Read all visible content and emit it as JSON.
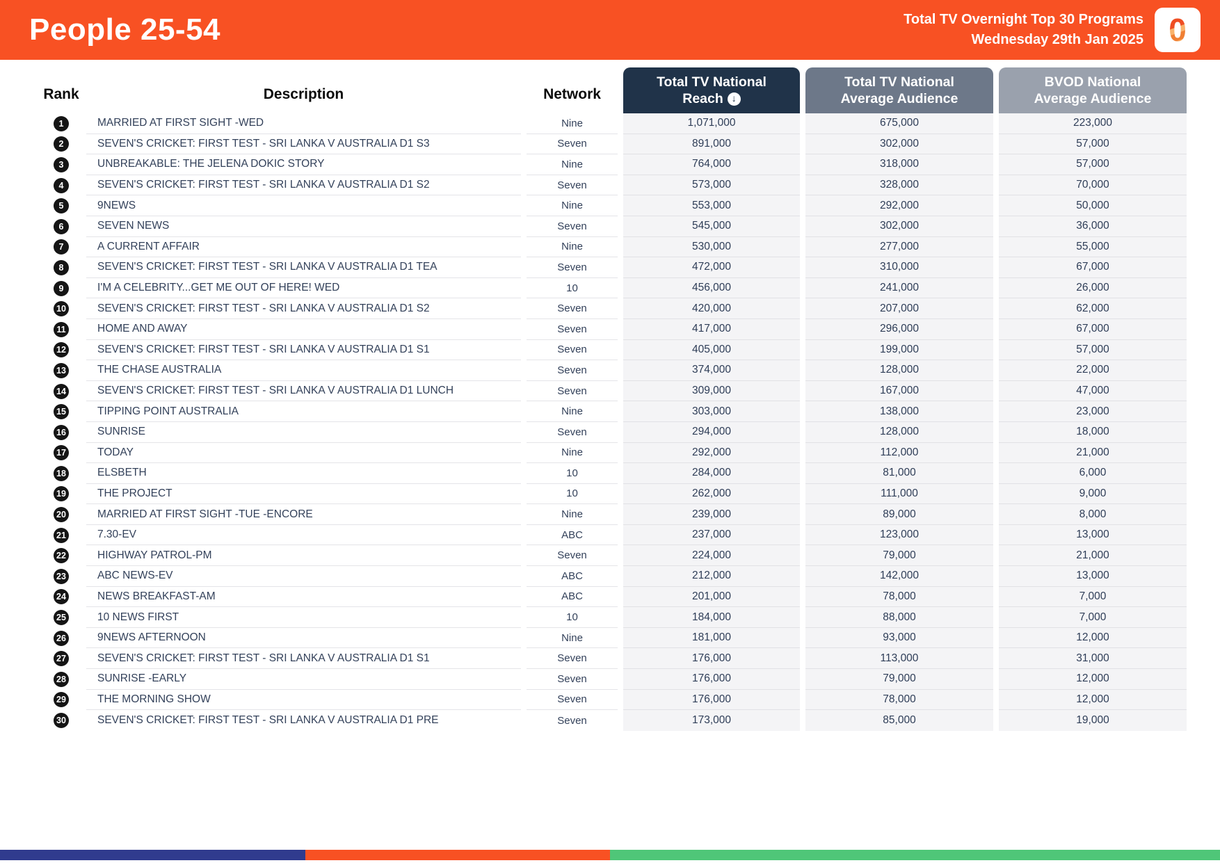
{
  "header": {
    "title": "People 25-54",
    "subtitle_line1": "Total TV Overnight Top 30 Programs",
    "subtitle_line2": "Wednesday 29th Jan 2025",
    "logo_text": "0",
    "bg_color": "#F85123"
  },
  "table": {
    "columns": {
      "rank": "Rank",
      "description": "Description",
      "network": "Network",
      "reach_line1": "Total TV National",
      "reach_line2": "Reach",
      "avg_line1": "Total TV National",
      "avg_line2": "Average Audience",
      "bvod_line1": "BVOD National",
      "bvod_line2": "Average Audience"
    },
    "sort_icon": "↓",
    "header_colors": {
      "reach": "#203349",
      "avg": "#6D7889",
      "bvod": "#9AA1AD"
    },
    "rows": [
      {
        "rank": "1",
        "description": "MARRIED AT FIRST SIGHT -WED",
        "network": "Nine",
        "reach": "1,071,000",
        "avg": "675,000",
        "bvod": "223,000"
      },
      {
        "rank": "2",
        "description": "SEVEN'S CRICKET: FIRST TEST - SRI LANKA V AUSTRALIA D1 S3",
        "network": "Seven",
        "reach": "891,000",
        "avg": "302,000",
        "bvod": "57,000"
      },
      {
        "rank": "3",
        "description": "UNBREAKABLE: THE JELENA DOKIC STORY",
        "network": "Nine",
        "reach": "764,000",
        "avg": "318,000",
        "bvod": "57,000"
      },
      {
        "rank": "4",
        "description": "SEVEN'S CRICKET: FIRST TEST - SRI LANKA V AUSTRALIA D1 S2",
        "network": "Seven",
        "reach": "573,000",
        "avg": "328,000",
        "bvod": "70,000"
      },
      {
        "rank": "5",
        "description": "9NEWS",
        "network": "Nine",
        "reach": "553,000",
        "avg": "292,000",
        "bvod": "50,000"
      },
      {
        "rank": "6",
        "description": "SEVEN NEWS",
        "network": "Seven",
        "reach": "545,000",
        "avg": "302,000",
        "bvod": "36,000"
      },
      {
        "rank": "7",
        "description": "A CURRENT AFFAIR",
        "network": "Nine",
        "reach": "530,000",
        "avg": "277,000",
        "bvod": "55,000"
      },
      {
        "rank": "8",
        "description": "SEVEN'S CRICKET: FIRST TEST - SRI LANKA V AUSTRALIA D1 TEA",
        "network": "Seven",
        "reach": "472,000",
        "avg": "310,000",
        "bvod": "67,000"
      },
      {
        "rank": "9",
        "description": "I'M A CELEBRITY...GET ME OUT OF HERE! WED",
        "network": "10",
        "reach": "456,000",
        "avg": "241,000",
        "bvod": "26,000"
      },
      {
        "rank": "10",
        "description": "SEVEN'S CRICKET: FIRST TEST - SRI LANKA V AUSTRALIA D1 S2",
        "network": "Seven",
        "reach": "420,000",
        "avg": "207,000",
        "bvod": "62,000"
      },
      {
        "rank": "11",
        "description": "HOME AND AWAY",
        "network": "Seven",
        "reach": "417,000",
        "avg": "296,000",
        "bvod": "67,000"
      },
      {
        "rank": "12",
        "description": "SEVEN'S CRICKET: FIRST TEST - SRI LANKA V AUSTRALIA D1 S1",
        "network": "Seven",
        "reach": "405,000",
        "avg": "199,000",
        "bvod": "57,000"
      },
      {
        "rank": "13",
        "description": "THE CHASE AUSTRALIA",
        "network": "Seven",
        "reach": "374,000",
        "avg": "128,000",
        "bvod": "22,000"
      },
      {
        "rank": "14",
        "description": "SEVEN'S CRICKET: FIRST TEST - SRI LANKA V AUSTRALIA D1 LUNCH",
        "network": "Seven",
        "reach": "309,000",
        "avg": "167,000",
        "bvod": "47,000"
      },
      {
        "rank": "15",
        "description": "TIPPING POINT AUSTRALIA",
        "network": "Nine",
        "reach": "303,000",
        "avg": "138,000",
        "bvod": "23,000"
      },
      {
        "rank": "16",
        "description": "SUNRISE",
        "network": "Seven",
        "reach": "294,000",
        "avg": "128,000",
        "bvod": "18,000"
      },
      {
        "rank": "17",
        "description": "TODAY",
        "network": "Nine",
        "reach": "292,000",
        "avg": "112,000",
        "bvod": "21,000"
      },
      {
        "rank": "18",
        "description": "ELSBETH",
        "network": "10",
        "reach": "284,000",
        "avg": "81,000",
        "bvod": "6,000"
      },
      {
        "rank": "19",
        "description": "THE PROJECT",
        "network": "10",
        "reach": "262,000",
        "avg": "111,000",
        "bvod": "9,000"
      },
      {
        "rank": "20",
        "description": "MARRIED AT FIRST SIGHT -TUE -ENCORE",
        "network": "Nine",
        "reach": "239,000",
        "avg": "89,000",
        "bvod": "8,000"
      },
      {
        "rank": "21",
        "description": "7.30-EV",
        "network": "ABC",
        "reach": "237,000",
        "avg": "123,000",
        "bvod": "13,000"
      },
      {
        "rank": "22",
        "description": "HIGHWAY PATROL-PM",
        "network": "Seven",
        "reach": "224,000",
        "avg": "79,000",
        "bvod": "21,000"
      },
      {
        "rank": "23",
        "description": "ABC NEWS-EV",
        "network": "ABC",
        "reach": "212,000",
        "avg": "142,000",
        "bvod": "13,000"
      },
      {
        "rank": "24",
        "description": "NEWS BREAKFAST-AM",
        "network": "ABC",
        "reach": "201,000",
        "avg": "78,000",
        "bvod": "7,000"
      },
      {
        "rank": "25",
        "description": "10 NEWS FIRST",
        "network": "10",
        "reach": "184,000",
        "avg": "88,000",
        "bvod": "7,000"
      },
      {
        "rank": "26",
        "description": "9NEWS AFTERNOON",
        "network": "Nine",
        "reach": "181,000",
        "avg": "93,000",
        "bvod": "12,000"
      },
      {
        "rank": "27",
        "description": "SEVEN'S CRICKET: FIRST TEST - SRI LANKA V AUSTRALIA D1 S1",
        "network": "Seven",
        "reach": "176,000",
        "avg": "113,000",
        "bvod": "31,000"
      },
      {
        "rank": "28",
        "description": "SUNRISE -EARLY",
        "network": "Seven",
        "reach": "176,000",
        "avg": "79,000",
        "bvod": "12,000"
      },
      {
        "rank": "29",
        "description": "THE MORNING SHOW",
        "network": "Seven",
        "reach": "176,000",
        "avg": "78,000",
        "bvod": "12,000"
      },
      {
        "rank": "30",
        "description": "SEVEN'S CRICKET: FIRST TEST - SRI LANKA V AUSTRALIA D1 PRE",
        "network": "Seven",
        "reach": "173,000",
        "avg": "85,000",
        "bvod": "19,000"
      }
    ]
  },
  "footer": {
    "segments": [
      {
        "color": "#303B8E",
        "width_pct": 25
      },
      {
        "color": "#F85123",
        "width_pct": 25
      },
      {
        "color": "#4FC678",
        "width_pct": 50
      }
    ]
  }
}
